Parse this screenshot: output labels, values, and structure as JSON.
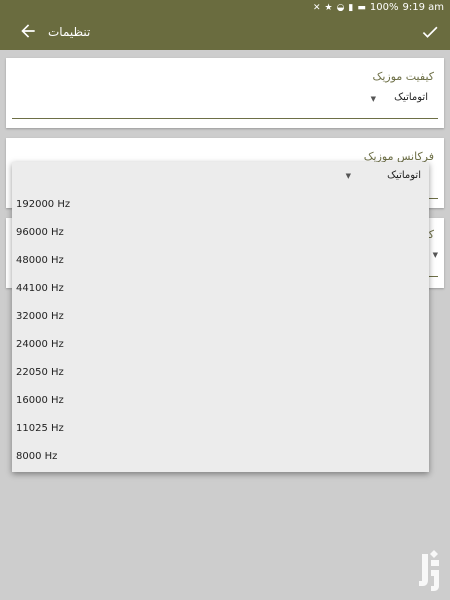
{
  "status": {
    "battery": "100%",
    "time": "9:19 am"
  },
  "appbar": {
    "title": "تنظیمات"
  },
  "settings": [
    {
      "label": "کیفیت موزیک",
      "value": "اتوماتیک"
    },
    {
      "label": "فرکانس موزیک",
      "value": "اتوماتیک"
    },
    {
      "label": "کا"
    }
  ],
  "dropdown": {
    "selected": "اتوماتیک",
    "options": [
      "192000 Hz",
      "96000 Hz",
      "48000 Hz",
      "44100 Hz",
      "32000 Hz",
      "24000 Hz",
      "22050 Hz",
      "16000 Hz",
      "11025 Hz",
      "8000 Hz"
    ]
  }
}
